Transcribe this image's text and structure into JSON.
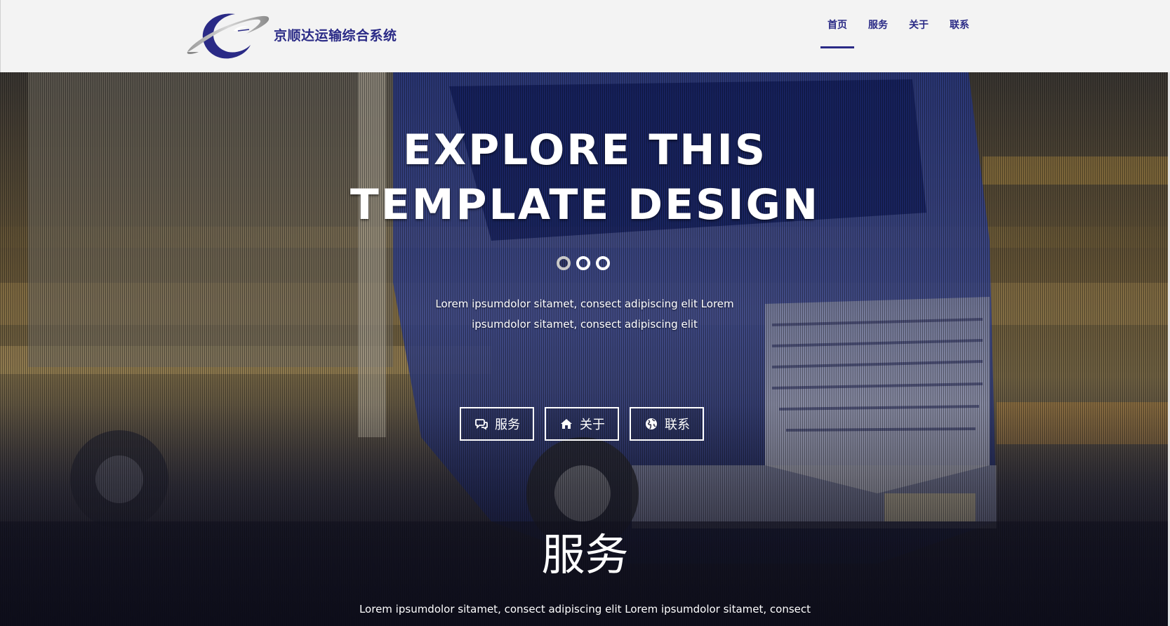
{
  "header": {
    "brand": "京顺达运输综合系统",
    "nav": [
      {
        "label": "首页",
        "active": true
      },
      {
        "label": "服务",
        "active": false
      },
      {
        "label": "关于",
        "active": false
      },
      {
        "label": "联系",
        "active": false
      }
    ]
  },
  "hero": {
    "title_line1": "EXPLORE THIS",
    "title_line2": "TEMPLATE DESIGN",
    "slider": {
      "count": 3,
      "active_index": 0
    },
    "text_line1": "Lorem ipsumdolor sitamet, consect adipiscing elit Lorem",
    "text_line2": "ipsumdolor sitamet, consect adipiscing elit",
    "buttons": [
      {
        "label": "服务",
        "icon": "comments-icon"
      },
      {
        "label": "关于",
        "icon": "home-icon"
      },
      {
        "label": "联系",
        "icon": "globe-icon"
      }
    ]
  },
  "services_section": {
    "title": "服务",
    "text": "Lorem ipsumdolor sitamet, consect adipiscing elit Lorem ipsumdolor sitamet, consect"
  },
  "colors": {
    "brand": "#2a2a86",
    "header_bg": "#f3f3f3",
    "hero_text": "#ffffff"
  }
}
